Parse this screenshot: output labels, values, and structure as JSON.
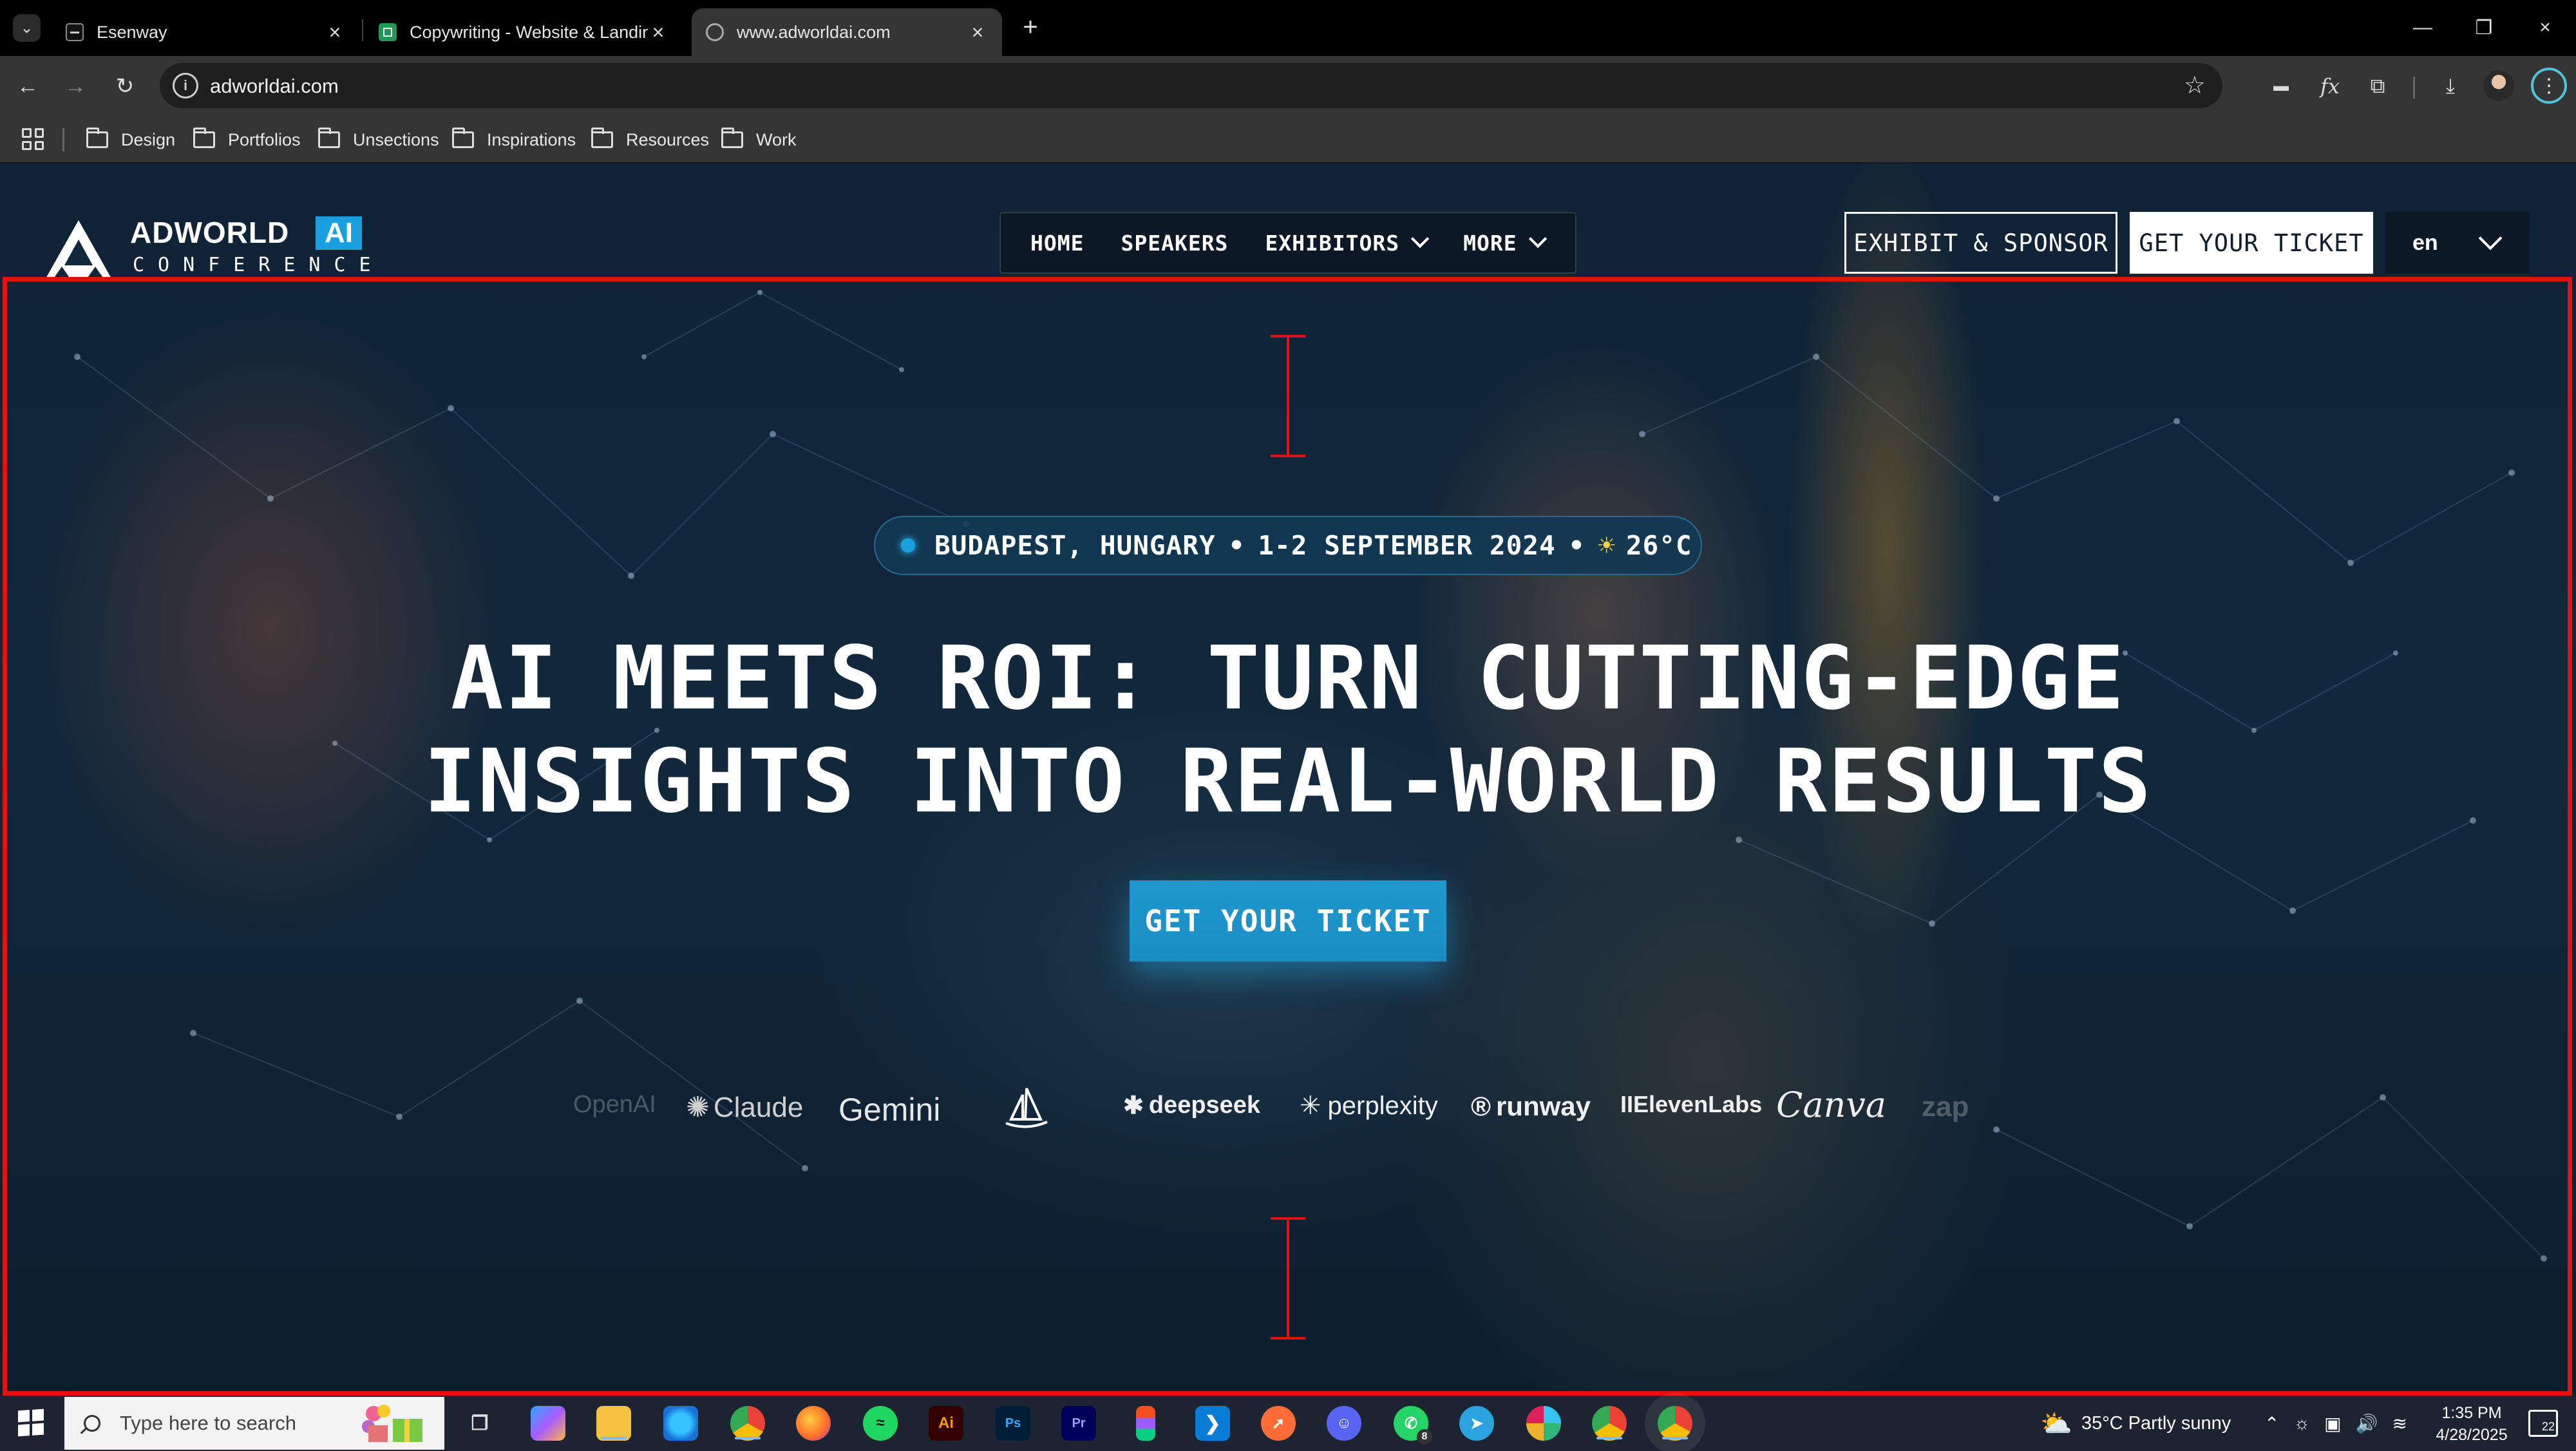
{
  "browser": {
    "tabs": [
      {
        "label": "Esenway",
        "active": false
      },
      {
        "label": "Copywriting - Website & Landin",
        "active": false
      },
      {
        "label": "www.adworldai.com",
        "active": true
      }
    ],
    "url": "adworldai.com",
    "bookmarks": [
      "Design",
      "Portfolios",
      "Unsections",
      "Inspirations",
      "Resources",
      "Work"
    ]
  },
  "site": {
    "logo": {
      "name": "ADWORLD",
      "badge": "AI",
      "sub": "CONFERENCE"
    },
    "nav": [
      {
        "label": "HOME",
        "dropdown": false
      },
      {
        "label": "SPEAKERS",
        "dropdown": false
      },
      {
        "label": "EXHIBITORS",
        "dropdown": true
      },
      {
        "label": "MORE",
        "dropdown": true
      }
    ],
    "exhibit_button": "EXHIBIT & SPONSOR",
    "ticket_button": "GET YOUR TICKET",
    "language": "en"
  },
  "hero": {
    "location": "BUDAPEST, HUNGARY",
    "dates": "1-2 SEPTEMBER 2024",
    "weather": "26°C",
    "title_line1": "AI MEETS ROI: TURN CUTTING-EDGE",
    "title_line2": "INSIGHTS INTO REAL-WORLD RESULTS",
    "cta": "GET YOUR TICKET",
    "partner_logos": [
      "OpenAI",
      "Claude",
      "Gemini",
      "Midjourney",
      "deepseek",
      "perplexity",
      "runway",
      "IIElevenLabs",
      "Canva",
      "zap"
    ]
  },
  "taskbar": {
    "search_placeholder": "Type here to search",
    "weather": "35°C  Partly sunny",
    "time": "1:35 PM",
    "date": "4/28/2025",
    "notifications": "22",
    "whatsapp_badge": "8"
  },
  "colors": {
    "accent": "#1aa0e0",
    "annotation": "#e01212",
    "hero_bg": "#12283c"
  }
}
